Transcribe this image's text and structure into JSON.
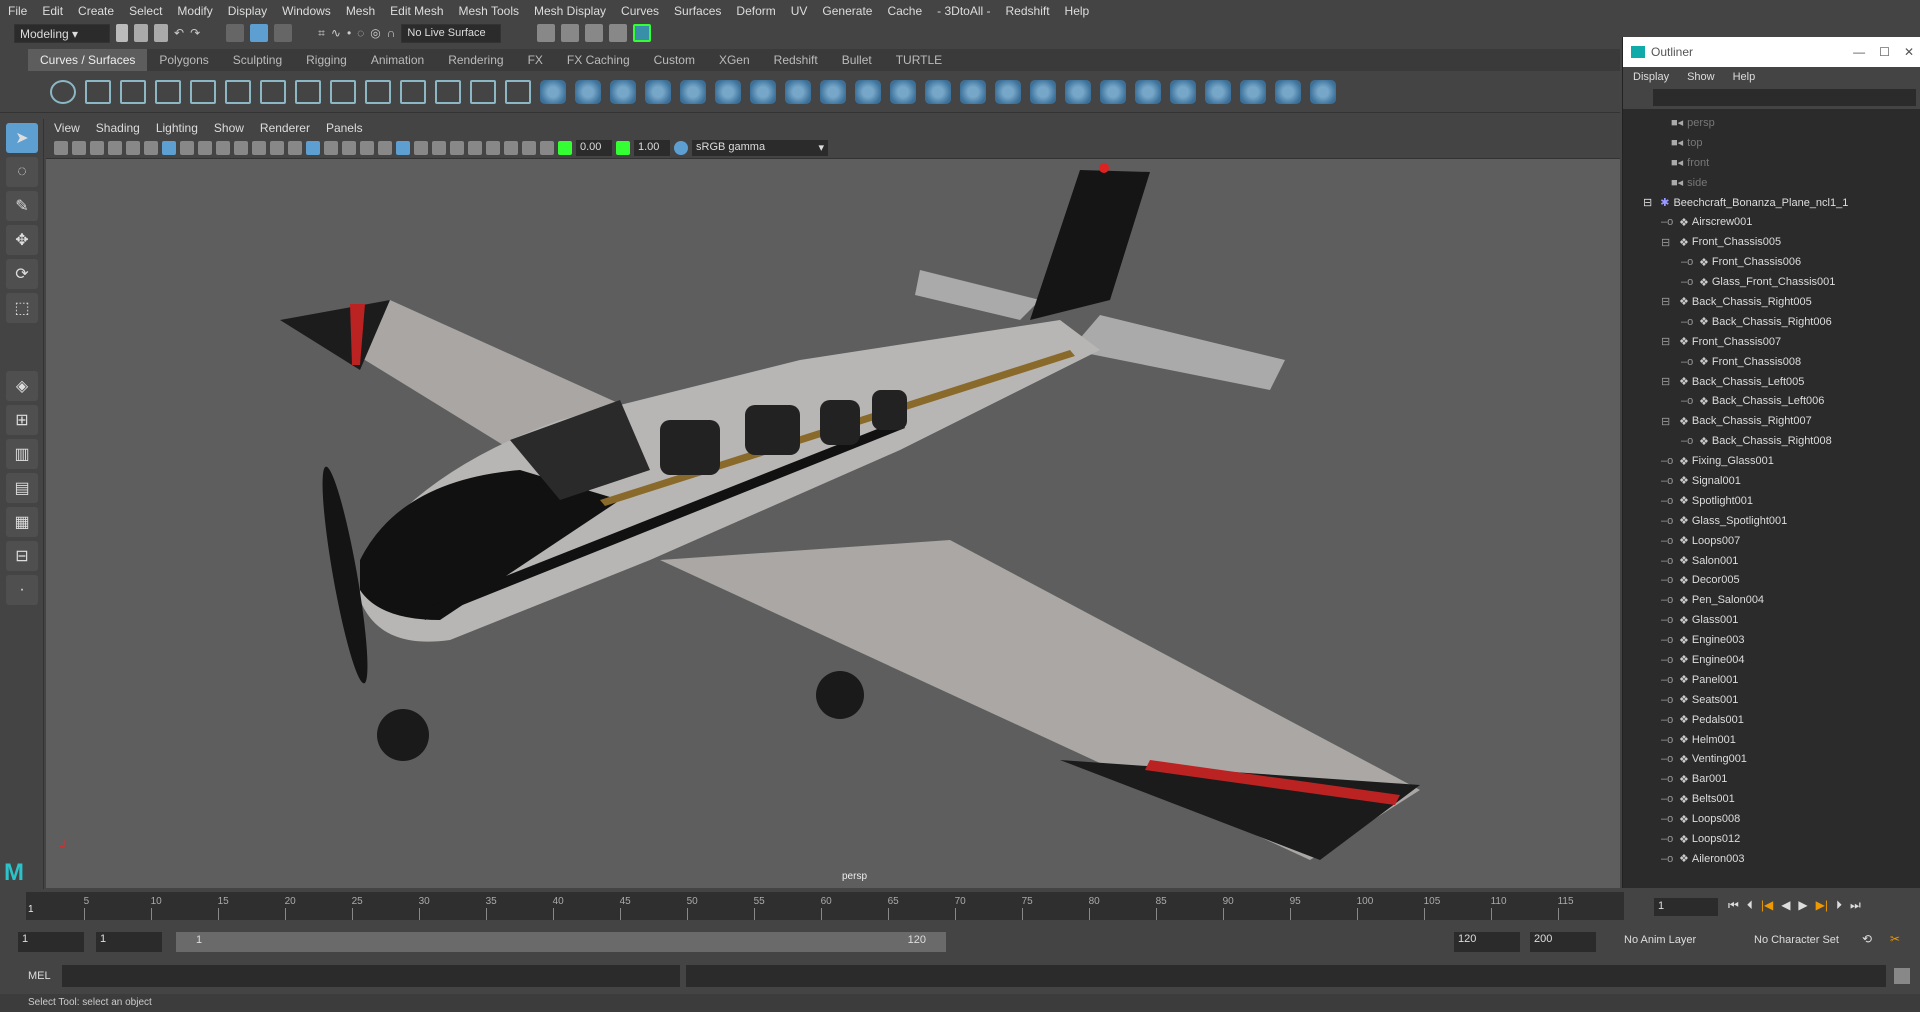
{
  "menubar": [
    "File",
    "Edit",
    "Create",
    "Select",
    "Modify",
    "Display",
    "Windows",
    "Mesh",
    "Edit Mesh",
    "Mesh Tools",
    "Mesh Display",
    "Curves",
    "Surfaces",
    "Deform",
    "UV",
    "Generate",
    "Cache",
    "- 3DtoAll -",
    "Redshift",
    "Help"
  ],
  "status": {
    "workspace": "Modeling",
    "live_surface": "No Live Surface"
  },
  "shelf_tabs": [
    "Curves / Surfaces",
    "Polygons",
    "Sculpting",
    "Rigging",
    "Animation",
    "Rendering",
    "FX",
    "FX Caching",
    "Custom",
    "XGen",
    "Redshift",
    "Bullet",
    "TURTLE"
  ],
  "viewport": {
    "menu": [
      "View",
      "Shading",
      "Lighting",
      "Show",
      "Renderer",
      "Panels"
    ],
    "exposure": "0.00",
    "gamma": "1.00",
    "color_space": "sRGB gamma",
    "camera_label": "persp"
  },
  "outliner": {
    "title": "Outliner",
    "menu": [
      "Display",
      "Show",
      "Help"
    ],
    "cameras": [
      "persp",
      "top",
      "front",
      "side"
    ],
    "root": "Beechcraft_Bonanza_Plane_ncl1_1",
    "items": [
      {
        "name": "Airscrew001",
        "level": 1,
        "group": false
      },
      {
        "name": "Front_Chassis005",
        "level": 1,
        "group": true
      },
      {
        "name": "Front_Chassis006",
        "level": 2,
        "group": false
      },
      {
        "name": "Glass_Front_Chassis001",
        "level": 2,
        "group": false
      },
      {
        "name": "Back_Chassis_Right005",
        "level": 1,
        "group": true
      },
      {
        "name": "Back_Chassis_Right006",
        "level": 2,
        "group": false
      },
      {
        "name": "Front_Chassis007",
        "level": 1,
        "group": true
      },
      {
        "name": "Front_Chassis008",
        "level": 2,
        "group": false
      },
      {
        "name": "Back_Chassis_Left005",
        "level": 1,
        "group": true
      },
      {
        "name": "Back_Chassis_Left006",
        "level": 2,
        "group": false
      },
      {
        "name": "Back_Chassis_Right007",
        "level": 1,
        "group": true
      },
      {
        "name": "Back_Chassis_Right008",
        "level": 2,
        "group": false
      },
      {
        "name": "Fixing_Glass001",
        "level": 1,
        "group": false
      },
      {
        "name": "Signal001",
        "level": 1,
        "group": false
      },
      {
        "name": "Spotlight001",
        "level": 1,
        "group": false
      },
      {
        "name": "Glass_Spotlight001",
        "level": 1,
        "group": false
      },
      {
        "name": "Loops007",
        "level": 1,
        "group": false
      },
      {
        "name": "Salon001",
        "level": 1,
        "group": false
      },
      {
        "name": "Decor005",
        "level": 1,
        "group": false
      },
      {
        "name": "Pen_Salon004",
        "level": 1,
        "group": false
      },
      {
        "name": "Glass001",
        "level": 1,
        "group": false
      },
      {
        "name": "Engine003",
        "level": 1,
        "group": false
      },
      {
        "name": "Engine004",
        "level": 1,
        "group": false
      },
      {
        "name": "Panel001",
        "level": 1,
        "group": false
      },
      {
        "name": "Seats001",
        "level": 1,
        "group": false
      },
      {
        "name": "Pedals001",
        "level": 1,
        "group": false
      },
      {
        "name": "Helm001",
        "level": 1,
        "group": false
      },
      {
        "name": "Venting001",
        "level": 1,
        "group": false
      },
      {
        "name": "Bar001",
        "level": 1,
        "group": false
      },
      {
        "name": "Belts001",
        "level": 1,
        "group": false
      },
      {
        "name": "Loops008",
        "level": 1,
        "group": false
      },
      {
        "name": "Loops012",
        "level": 1,
        "group": false
      },
      {
        "name": "Aileron003",
        "level": 1,
        "group": false
      }
    ]
  },
  "timeline": {
    "ticks": [
      "5",
      "10",
      "15",
      "20",
      "25",
      "30",
      "35",
      "40",
      "45",
      "50",
      "55",
      "60",
      "65",
      "70",
      "75",
      "80",
      "85",
      "90",
      "95",
      "100",
      "105",
      "110",
      "115"
    ],
    "current_frame_marker": "1",
    "current_frame": "1"
  },
  "range": {
    "start": "1",
    "playback_start": "1",
    "slider_start": "1",
    "slider_end": "120",
    "playback_end": "120",
    "end": "200",
    "anim_layer": "No Anim Layer",
    "character_set": "No Character Set"
  },
  "cmd": {
    "label": "MEL"
  },
  "help_line": "Select Tool: select an object",
  "colors": {
    "accent": "#5d9fd0",
    "bg": "#444444",
    "viewport": "#5e5e5e"
  }
}
